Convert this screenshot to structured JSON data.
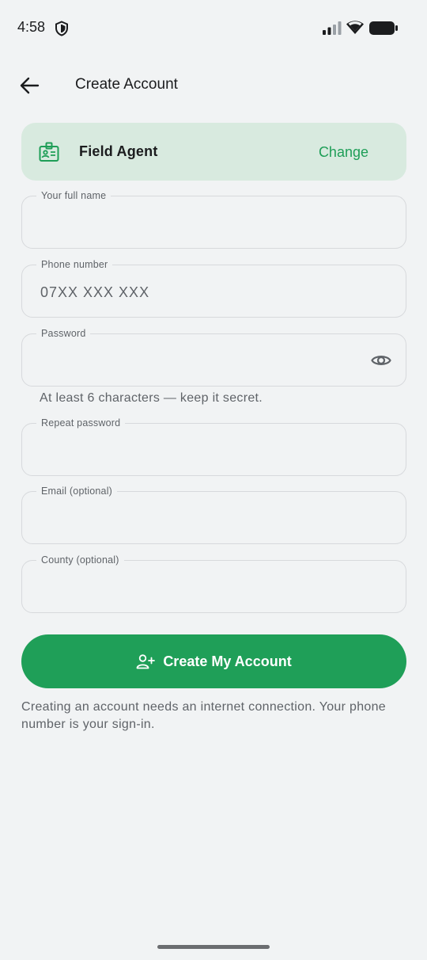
{
  "status_bar": {
    "time": "4:58"
  },
  "app_bar": {
    "title": "Create Account"
  },
  "role_card": {
    "name": "Field Agent",
    "change_label": "Change"
  },
  "fields": {
    "full_name": {
      "label": "Your full name",
      "value": "",
      "placeholder": ""
    },
    "phone": {
      "label": "Phone number",
      "value": "",
      "placeholder": "07XX XXX XXX"
    },
    "password": {
      "label": "Password",
      "value": "",
      "placeholder": "",
      "helper": "At least 6 characters — keep it secret."
    },
    "repeat_password": {
      "label": "Repeat password",
      "value": "",
      "placeholder": ""
    },
    "email": {
      "label": "Email (optional)",
      "value": "",
      "placeholder": ""
    },
    "county": {
      "label": "County (optional)",
      "value": "",
      "placeholder": ""
    }
  },
  "cta": {
    "label": "Create My Account"
  },
  "note": "Creating an account needs an internet connection. Your phone number is your sign-in.",
  "icons": {
    "back": "arrow-back-icon",
    "role": "id-badge-icon",
    "password_toggle": "eye-icon",
    "cta": "person-add-icon",
    "status": [
      "shield-icon",
      "signal-icon",
      "wifi-icon",
      "battery-icon"
    ]
  },
  "colors": {
    "accent": "#1f9f58",
    "role_card_bg": "#d8eadf",
    "background": "#f1f3f4",
    "text_secondary": "#5f6368"
  }
}
